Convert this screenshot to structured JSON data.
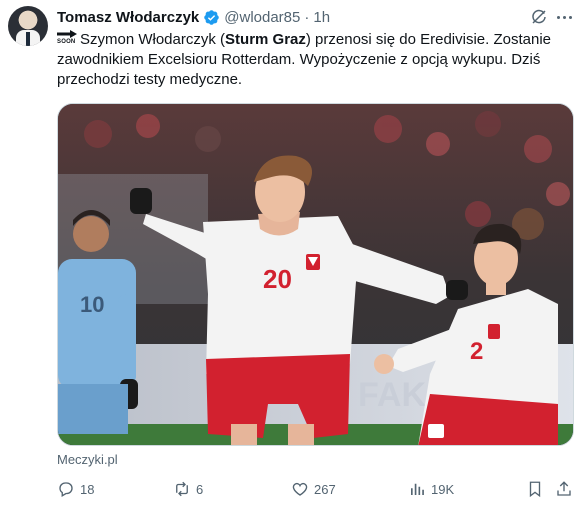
{
  "tweet": {
    "author_name": "Tomasz Włodarczyk",
    "handle": "@wlodar85",
    "separator": "·",
    "time": "1h",
    "arrow_label": "SOON",
    "text_before_bold": "Szymon Włodarczyk (",
    "text_bold": "Sturm Graz",
    "text_after_bold": ") przenosi się do Eredivisie. Zostanie zawodnikiem Excelsioru Rotterdam. Wypożyczenie z opcją wykupu. Dziś przechodzi testy medyczne.",
    "source": "Meczyki.pl"
  },
  "media": {
    "left_player_number": "10",
    "main_player_number": "20",
    "right_player_number": "2",
    "board_text": "FAK"
  },
  "actions": {
    "replies": "18",
    "reposts": "6",
    "likes": "267",
    "views": "19K"
  },
  "colors": {
    "verified": "#1d9bf0",
    "secondary_text": "#536471",
    "primary_text": "#0f1419",
    "poland_red": "#d2212f",
    "poland_white": "#f3f3f3",
    "opponent_blue": "#7fb3dd"
  }
}
